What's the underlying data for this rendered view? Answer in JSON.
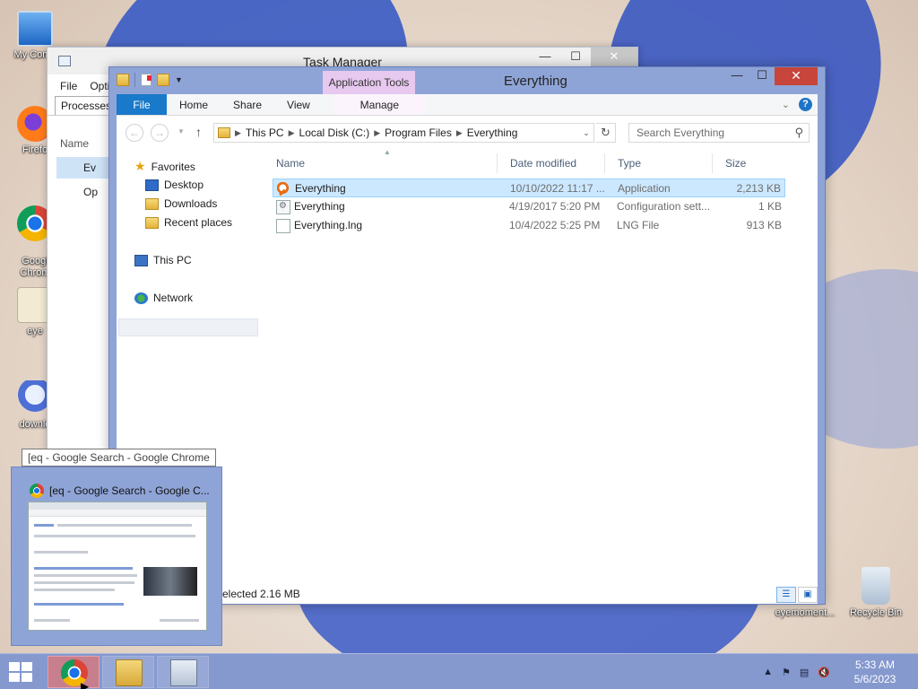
{
  "desktop": {
    "icons": [
      {
        "label": "My Comp",
        "kind": "pc"
      },
      {
        "label": "Firefo",
        "kind": "firefox"
      },
      {
        "label": "Googl\nChrom",
        "kind": "chrome"
      },
      {
        "label": "eye",
        "kind": "eye"
      },
      {
        "label": "downlo",
        "kind": "download"
      },
      {
        "label": "eyemoment...",
        "kind": "eyemoment"
      },
      {
        "label": "Recycle Bin",
        "kind": "recycle-bin"
      }
    ]
  },
  "task_manager": {
    "title": "Task Manager",
    "menu": [
      "File",
      "Opti"
    ],
    "tab": "Processes",
    "column": "Name",
    "rows": [
      "Ev",
      "Op"
    ]
  },
  "explorer": {
    "title": "Everything",
    "context_tab": "Application Tools",
    "ribbon_tabs": [
      "File",
      "Home",
      "Share",
      "View"
    ],
    "manage_tab": "Manage",
    "path": [
      "This PC",
      "Local Disk (C:)",
      "Program Files",
      "Everything"
    ],
    "search_placeholder": "Search Everything",
    "nav": {
      "favorites": "Favorites",
      "desktop": "Desktop",
      "downloads": "Downloads",
      "recent": "Recent places",
      "this_pc": "This PC",
      "network": "Network"
    },
    "columns": {
      "name": "Name",
      "date": "Date modified",
      "type": "Type",
      "size": "Size"
    },
    "files": [
      {
        "name": "Everything",
        "date": "10/10/2022 11:17 ...",
        "type": "Application",
        "size": "2,213 KB",
        "icon": "app-icon"
      },
      {
        "name": "Everything",
        "date": "4/19/2017 5:20 PM",
        "type": "Configuration sett...",
        "size": "1 KB",
        "icon": "config-file-icon"
      },
      {
        "name": "Everything.lng",
        "date": "10/4/2022 5:25 PM",
        "type": "LNG File",
        "size": "913 KB",
        "icon": "file-icon"
      }
    ],
    "status_text": "elected  2.16 MB"
  },
  "chrome_preview": {
    "tooltip": "[eq - Google Search - Google Chrome",
    "title": "[eq - Google Search - Google C..."
  },
  "taskbar": {
    "time": "5:33 AM",
    "date": "5/6/2023"
  }
}
